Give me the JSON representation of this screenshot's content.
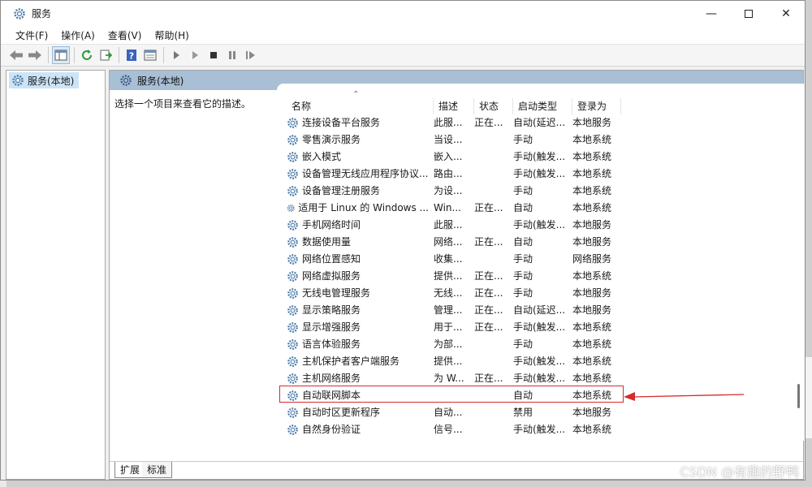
{
  "window": {
    "title": "服务"
  },
  "menu": [
    "文件(F)",
    "操作(A)",
    "查看(V)",
    "帮助(H)"
  ],
  "tree": {
    "root_label": "服务(本地)"
  },
  "detail": {
    "header_label": "服务(本地)",
    "description_prompt": "选择一个项目来查看它的描述。"
  },
  "columns": [
    "名称",
    "描述",
    "状态",
    "启动类型",
    "登录为"
  ],
  "services": [
    {
      "name": "连接设备平台服务",
      "desc": "此服...",
      "status": "正在...",
      "startup": "自动(延迟...",
      "logon": "本地服务"
    },
    {
      "name": "零售演示服务",
      "desc": "当设...",
      "status": "",
      "startup": "手动",
      "logon": "本地系统"
    },
    {
      "name": "嵌入模式",
      "desc": "嵌入...",
      "status": "",
      "startup": "手动(触发...",
      "logon": "本地系统"
    },
    {
      "name": "设备管理无线应用程序协议...",
      "desc": "路由...",
      "status": "",
      "startup": "手动(触发...",
      "logon": "本地系统"
    },
    {
      "name": "设备管理注册服务",
      "desc": "为设...",
      "status": "",
      "startup": "手动",
      "logon": "本地系统"
    },
    {
      "name": "适用于 Linux 的 Windows ...",
      "desc": "Win...",
      "status": "正在...",
      "startup": "自动",
      "logon": "本地系统"
    },
    {
      "name": "手机网络时间",
      "desc": "此服...",
      "status": "",
      "startup": "手动(触发...",
      "logon": "本地服务"
    },
    {
      "name": "数据使用量",
      "desc": "网络...",
      "status": "正在...",
      "startup": "自动",
      "logon": "本地服务"
    },
    {
      "name": "网络位置感知",
      "desc": "收集...",
      "status": "",
      "startup": "手动",
      "logon": "网络服务"
    },
    {
      "name": "网络虚拟服务",
      "desc": "提供...",
      "status": "正在...",
      "startup": "手动",
      "logon": "本地系统"
    },
    {
      "name": "无线电管理服务",
      "desc": "无线...",
      "status": "正在...",
      "startup": "手动",
      "logon": "本地服务"
    },
    {
      "name": "显示策略服务",
      "desc": "管理...",
      "status": "正在...",
      "startup": "自动(延迟...",
      "logon": "本地服务"
    },
    {
      "name": "显示增强服务",
      "desc": "用于...",
      "status": "正在...",
      "startup": "手动(触发...",
      "logon": "本地系统"
    },
    {
      "name": "语言体验服务",
      "desc": "为部...",
      "status": "",
      "startup": "手动",
      "logon": "本地系统"
    },
    {
      "name": "主机保护者客户端服务",
      "desc": "提供...",
      "status": "",
      "startup": "手动(触发...",
      "logon": "本地系统"
    },
    {
      "name": "主机网络服务",
      "desc": "为 W...",
      "status": "正在...",
      "startup": "手动(触发...",
      "logon": "本地系统"
    },
    {
      "name": "自动联网脚本",
      "desc": "",
      "status": "",
      "startup": "自动",
      "logon": "本地系统"
    },
    {
      "name": "自动时区更新程序",
      "desc": "自动...",
      "status": "",
      "startup": "禁用",
      "logon": "本地服务"
    },
    {
      "name": "自然身份验证",
      "desc": "信号...",
      "status": "",
      "startup": "手动(触发...",
      "logon": "本地系统"
    }
  ],
  "tabs": [
    "扩展",
    "标准"
  ],
  "watermark": "CSDN @有趣的野鸭",
  "icons": {
    "back": "arrow-left-icon",
    "forward": "arrow-right-icon",
    "console_tree": "console-tree-icon",
    "refresh": "refresh-icon",
    "export": "export-list-icon",
    "help": "help-icon",
    "properties": "properties-icon",
    "start": "play-icon",
    "start_alt": "play-outline-icon",
    "stop": "stop-icon",
    "pause": "pause-icon",
    "restart": "restart-icon",
    "service": "gear-icon"
  },
  "colors": {
    "header_bar": "#a8bfd6",
    "tree_selected": "#cce4f7",
    "annotation": "#d62b2b"
  }
}
